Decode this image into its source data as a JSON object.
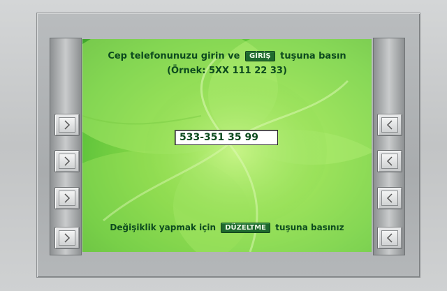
{
  "screen": {
    "instruction_before": "Cep telefonunuzu girin ve",
    "enter_key_label": "GİRİŞ",
    "instruction_after": "tuşuna basın",
    "example_text": "(Örnek: 5XX 111 22 33)",
    "phone_value": "533-351 35 99",
    "edit_before": "Değişiklik yapmak için",
    "correct_key_label": "DÜZELTME",
    "edit_after": "tuşuna basınız"
  },
  "side_keys": {
    "left": [
      "chevron-right-icon",
      "chevron-right-icon",
      "chevron-right-icon",
      "chevron-right-icon"
    ],
    "right": [
      "chevron-left-icon",
      "chevron-left-icon",
      "chevron-left-icon",
      "chevron-left-icon"
    ]
  },
  "colors": {
    "screen_green": "#8fdc4a",
    "text_dark_green": "#0c4a1e",
    "badge_green": "#1f6a2e"
  }
}
